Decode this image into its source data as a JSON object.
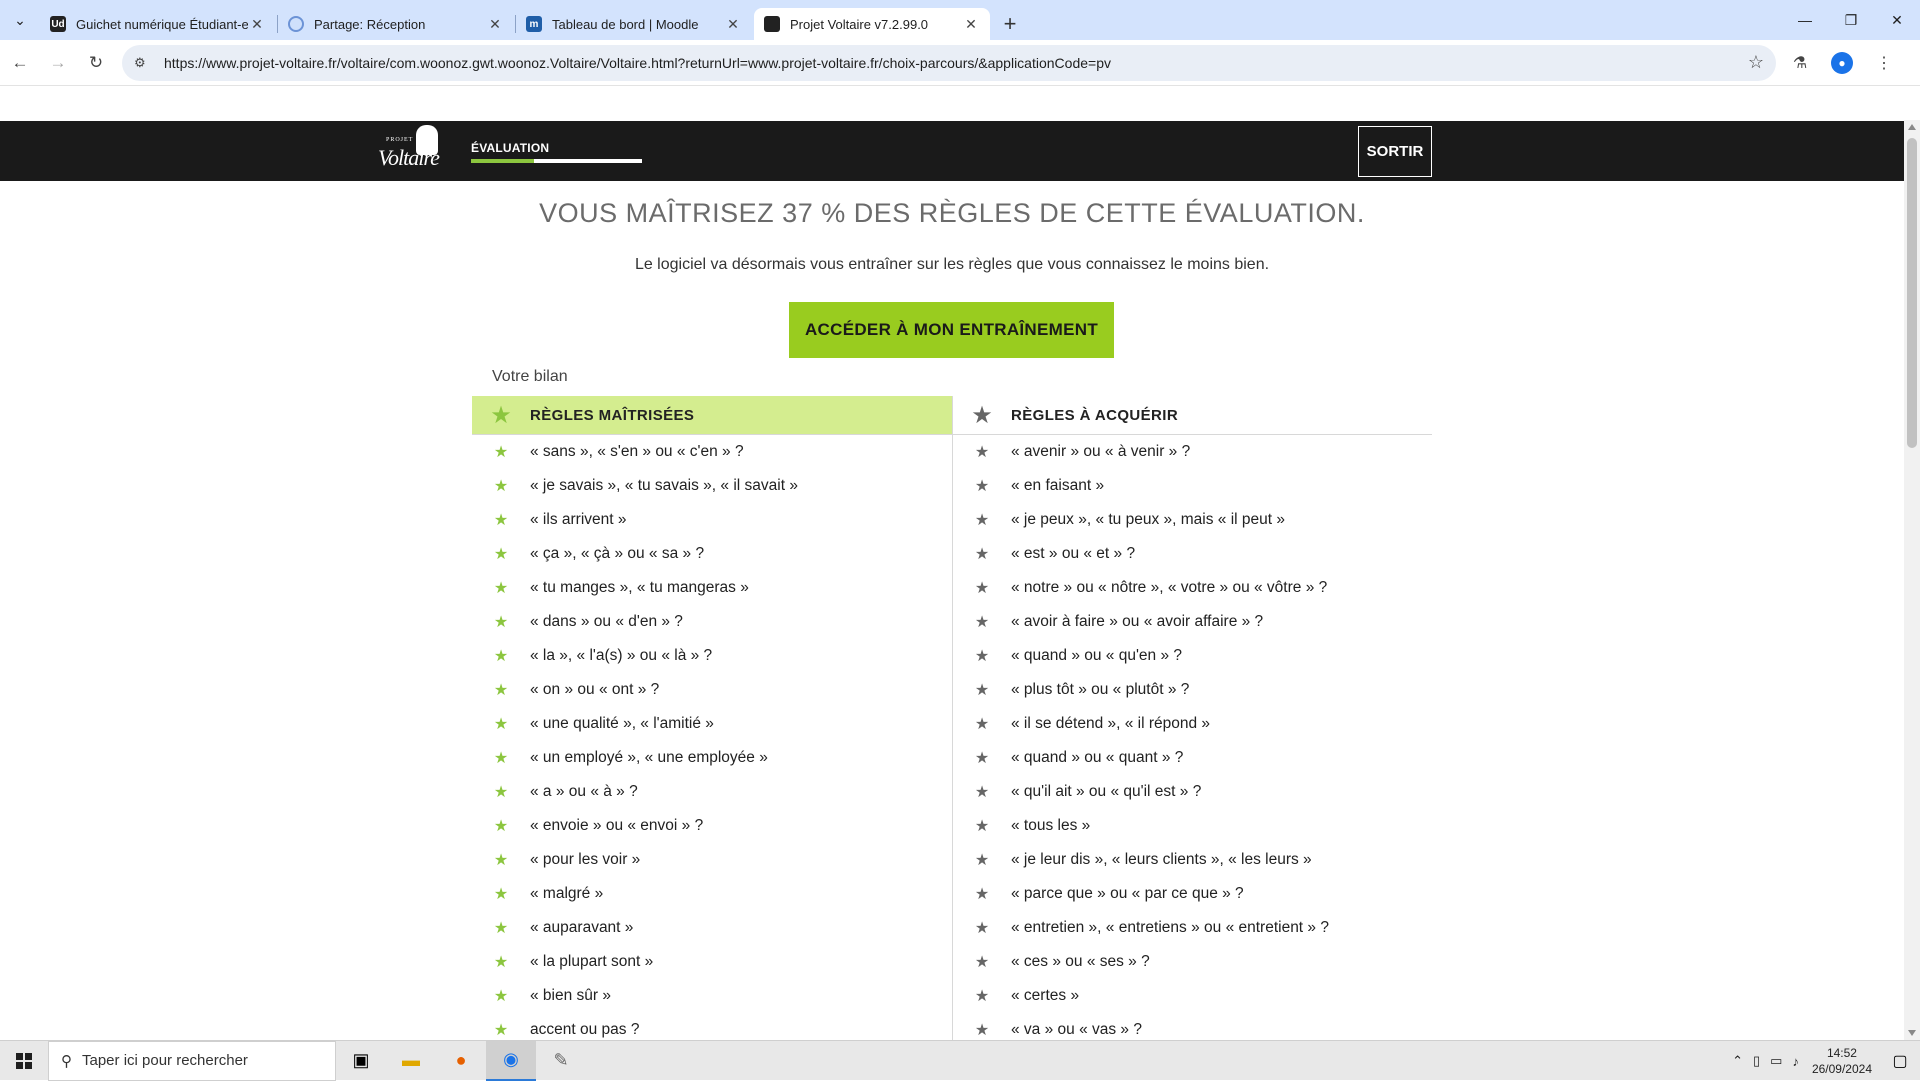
{
  "browser": {
    "tabs": [
      {
        "title": "Guichet numérique Étudiant-e-s",
        "favicon": "Ud"
      },
      {
        "title": "Partage: Réception",
        "favicon": ""
      },
      {
        "title": "Tableau de bord | Moodle",
        "favicon": "m"
      },
      {
        "title": "Projet Voltaire v7.2.99.0",
        "favicon": ""
      }
    ],
    "url": "https://www.projet-voltaire.fr/voltaire/com.woonoz.gwt.woonoz.Voltaire/Voltaire.html?returnUrl=www.projet-voltaire.fr/choix-parcours/&applicationCode=pv"
  },
  "header": {
    "logo_small": "PROJET",
    "logo_script": "Voltaire",
    "section_label": "ÉVALUATION",
    "progress_fraction": 0.37,
    "logout_label": "SORTIR"
  },
  "main": {
    "headline": "VOUS MAÎTRISEZ 37 % DES RÈGLES DE CETTE ÉVALUATION.",
    "subline": "Le logiciel va désormais vous entraîner sur les règles que vous connaissez le moins bien.",
    "cta_label": "ACCÉDER À MON ENTRAÎNEMENT",
    "bilan_label": "Votre bilan",
    "mastered_title": "RÈGLES MAÎTRISÉES",
    "to_learn_title": "RÈGLES À ACQUÉRIR",
    "mastered": [
      "« sans », « s'en » ou « c'en » ?",
      "« je savais », « tu savais », « il savait »",
      "« ils arrivent »",
      "« ça », « çà » ou « sa » ?",
      "« tu manges », « tu mangeras »",
      "« dans » ou « d'en » ?",
      "« la », « l'a(s) » ou « là » ?",
      "« on » ou « ont » ?",
      "« une qualité », « l'amitié »",
      "« un employé », « une employée »",
      "« a » ou « à » ?",
      "« envoie » ou « envoi » ?",
      "« pour les voir »",
      "« malgré »",
      "« auparavant »",
      "« la plupart sont »",
      "« bien sûr »",
      "accent ou pas ?"
    ],
    "to_learn": [
      "« avenir » ou « à venir » ?",
      "« en faisant »",
      "« je peux », « tu peux », mais « il peut »",
      "« est » ou « et » ?",
      "« notre » ou « nôtre », « votre » ou « vôtre » ?",
      "« avoir à faire » ou « avoir affaire » ?",
      "« quand » ou « qu'en » ?",
      "« plus tôt » ou « plutôt » ?",
      "« il se détend », « il répond »",
      "« quand » ou « quant » ?",
      "« qu'il ait » ou « qu'il est » ?",
      "« tous les »",
      "« je leur dis », « leurs clients », « les leurs »",
      "« parce que » ou « par ce que » ?",
      "« entretien », « entretiens » ou « entretient » ?",
      "« ces » ou « ses » ?",
      "« certes »",
      "« va » ou « vas » ?"
    ]
  },
  "taskbar": {
    "search_placeholder": "Taper ici pour rechercher",
    "time": "14:52",
    "date": "26/09/2024"
  },
  "colors": {
    "accent_green": "#99cc1f",
    "mastered_header_bg": "#d4ed8f",
    "header_bg": "#1a1a1a"
  }
}
